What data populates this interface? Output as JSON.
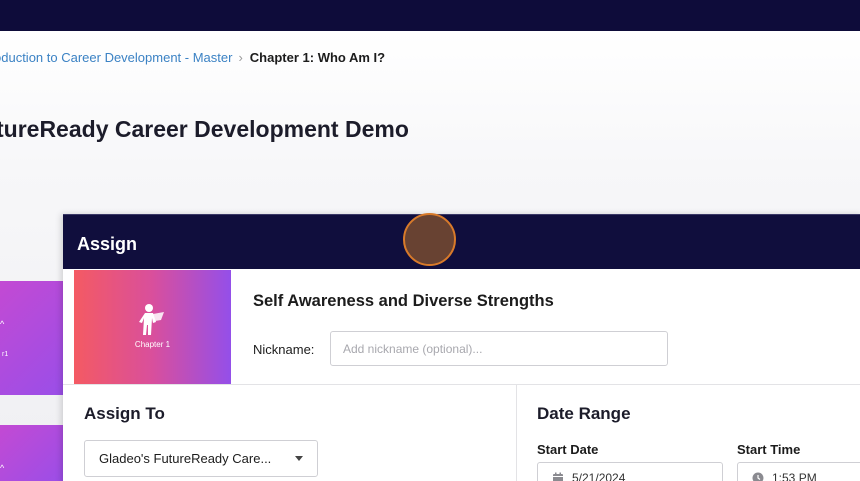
{
  "breadcrumb": {
    "parent": "oduction to Career Development - Master",
    "separator": "›",
    "current": "Chapter 1: Who Am I?"
  },
  "page": {
    "title": "tureReady Career Development Demo"
  },
  "side_cards": [
    {
      "mark": "^",
      "text": "r1"
    },
    {
      "mark": "^",
      "text": ""
    }
  ],
  "modal": {
    "title": "Assign",
    "thumbnail_label": "Chapter 1",
    "lesson_title": "Self Awareness and Diverse Strengths",
    "nickname_label": "Nickname:",
    "nickname_placeholder": "Add nickname (optional)...",
    "nickname_value": "",
    "assign_to": {
      "title": "Assign To",
      "selected": "Gladeo's FutureReady Care..."
    },
    "date_range": {
      "title": "Date Range",
      "start_date_label": "Start Date",
      "start_date_value": "5/21/2024",
      "start_time_label": "Start Time",
      "start_time_value": "1:53 PM"
    }
  },
  "colors": {
    "topbar": "#0e0c3a",
    "modal_header": "#100e3d",
    "link": "#3b82c4",
    "thumb_gradient_start": "#f45a63",
    "thumb_gradient_end": "#944fe9"
  }
}
